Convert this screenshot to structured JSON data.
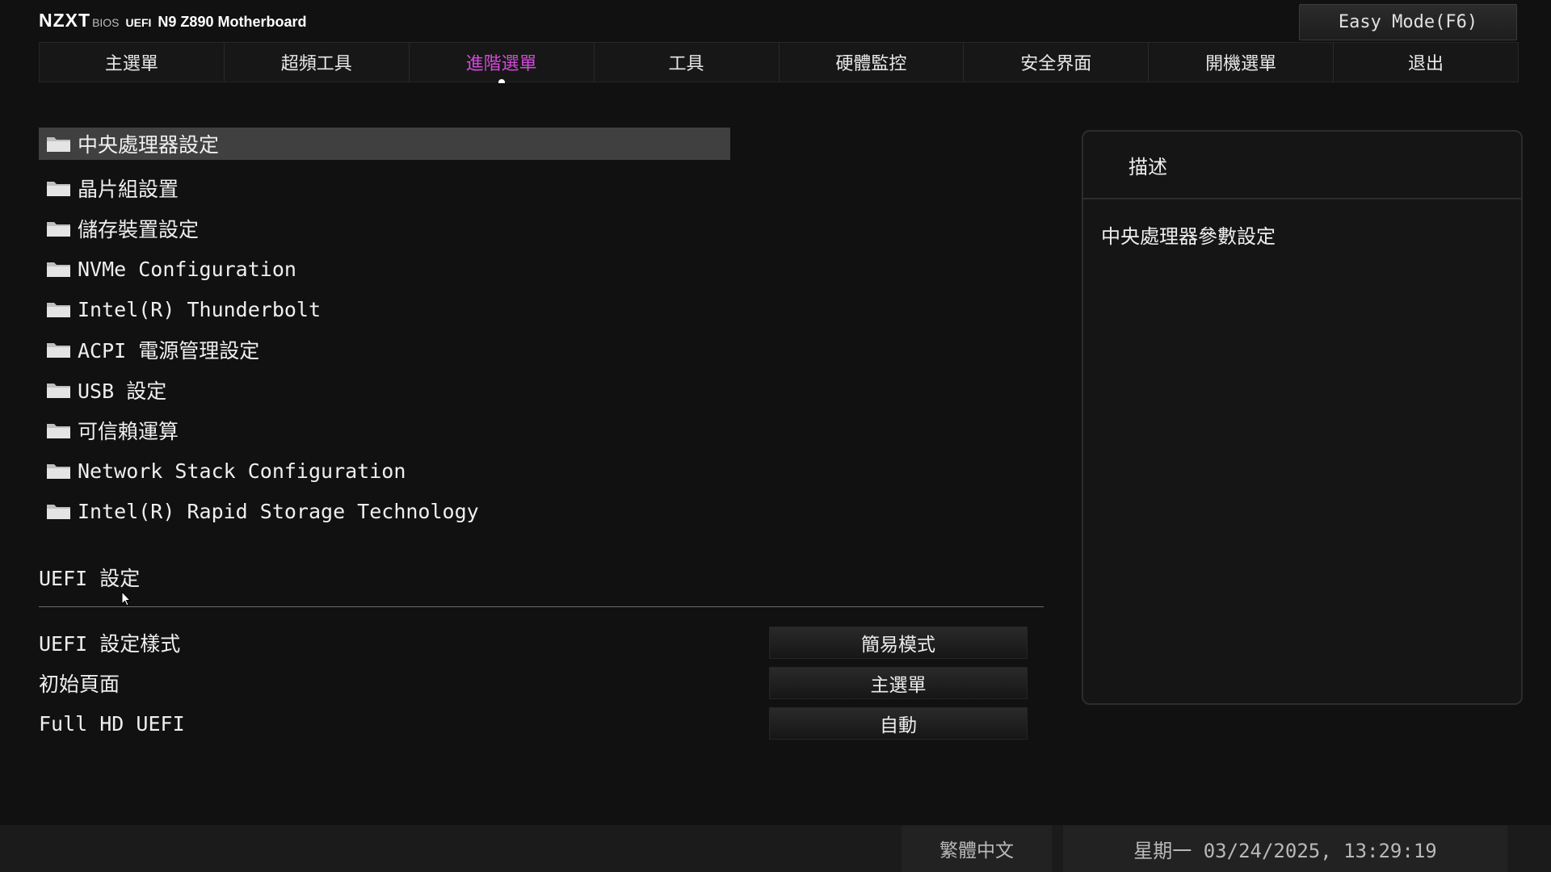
{
  "header": {
    "brand": "NZXT",
    "bios_label": "BIOS",
    "uefi_label": "UEFI",
    "model": "N9 Z890 Motherboard",
    "easy_mode_button": "Easy Mode(F6)"
  },
  "tabs": [
    {
      "label": "主選單"
    },
    {
      "label": "超頻工具"
    },
    {
      "label": "進階選單"
    },
    {
      "label": "工具"
    },
    {
      "label": "硬體監控"
    },
    {
      "label": "安全界面"
    },
    {
      "label": "開機選單"
    },
    {
      "label": "退出"
    }
  ],
  "active_tab": "進階選單",
  "menu": {
    "items": [
      {
        "label": "中央處理器設定",
        "icon": "folder-icon"
      },
      {
        "label": "晶片組設置",
        "icon": "folder-icon"
      },
      {
        "label": "儲存裝置設定",
        "icon": "folder-icon"
      },
      {
        "label": "NVMe Configuration",
        "icon": "folder-icon"
      },
      {
        "label": "Intel(R) Thunderbolt",
        "icon": "folder-icon"
      },
      {
        "label": "ACPI 電源管理設定",
        "icon": "folder-icon"
      },
      {
        "label": "USB 設定",
        "icon": "folder-icon"
      },
      {
        "label": "可信賴運算",
        "icon": "folder-icon"
      },
      {
        "label": "Network Stack Configuration",
        "icon": "folder-icon"
      },
      {
        "label": "Intel(R) Rapid Storage Technology",
        "icon": "folder-icon"
      }
    ],
    "selected": "中央處理器設定"
  },
  "uefi_settings": {
    "title": "UEFI 設定",
    "rows": [
      {
        "label": "UEFI 設定樣式",
        "value": "簡易模式"
      },
      {
        "label": "初始頁面",
        "value": "主選單"
      },
      {
        "label": "Full HD UEFI",
        "value": "自動"
      }
    ]
  },
  "description": {
    "title": "描述",
    "text": "中央處理器參數設定"
  },
  "footer": {
    "language": "繁體中文",
    "datetime": "星期一 03/24/2025, 13:29:19"
  },
  "colors": {
    "background": "#111111",
    "active_tab": "#d04ad8",
    "selected_row": "#404040"
  }
}
